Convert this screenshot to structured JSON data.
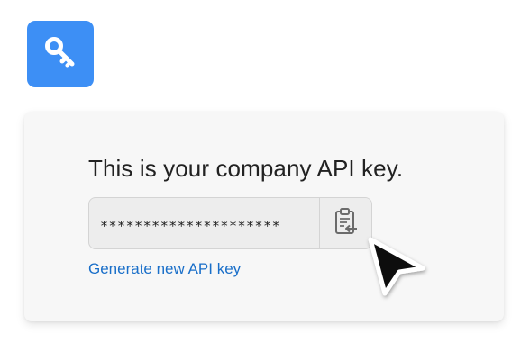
{
  "icons": {
    "app": "key-icon",
    "copy": "clipboard-copy-icon",
    "cursor": "mouse-pointer-icon"
  },
  "colors": {
    "accent": "#3d8ff5",
    "link": "#1a6fc9",
    "card_background": "#f7f7f7",
    "field_background": "#ededed"
  },
  "card": {
    "heading": "This is your company API key.",
    "api_key_masked": "*********************",
    "generate_link_label": "Generate new API key"
  }
}
